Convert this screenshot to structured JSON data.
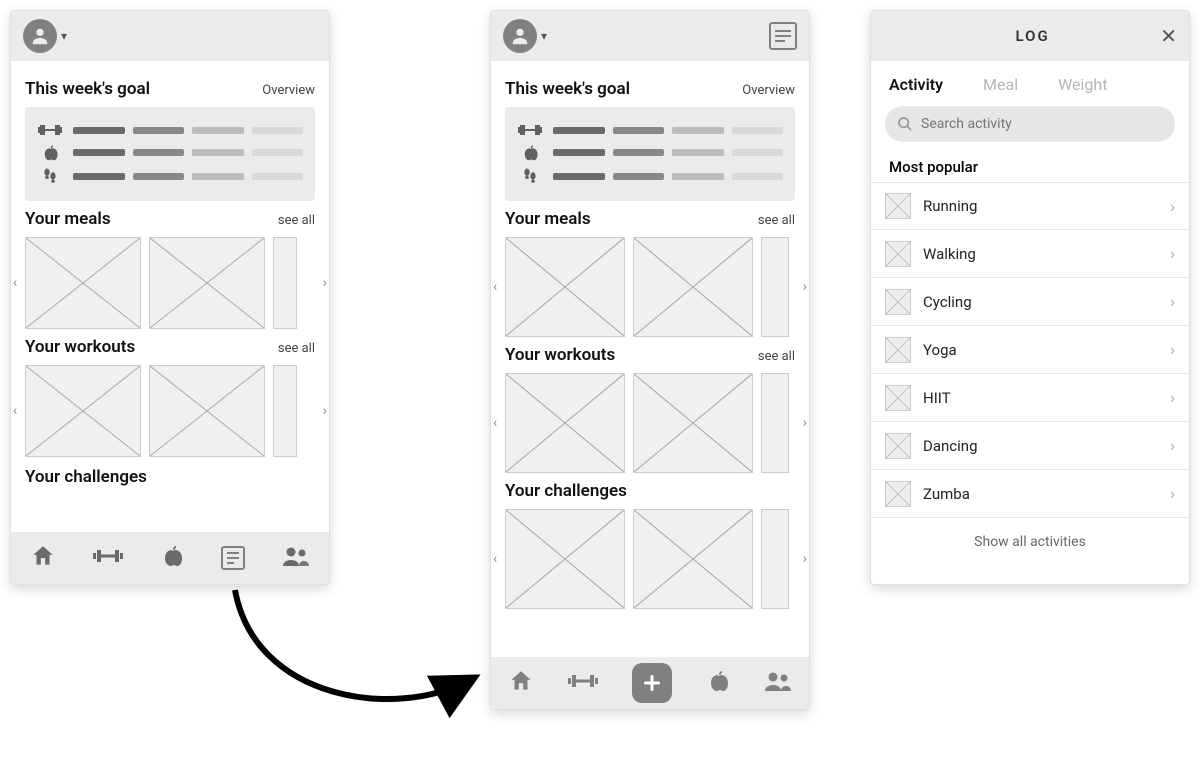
{
  "phoneA": {
    "sections": {
      "goal": {
        "title": "This week's goal",
        "link": "Overview"
      },
      "meals": {
        "title": "Your meals",
        "link": "see all"
      },
      "workouts": {
        "title": "Your workouts",
        "link": "see all"
      },
      "challenges": {
        "title": "Your challenges"
      }
    },
    "nav": {
      "home": "home-icon",
      "workout": "barbell-icon",
      "nutrition": "apple-icon",
      "log": "document-icon",
      "social": "people-icon"
    }
  },
  "phoneB": {
    "sections": {
      "goal": {
        "title": "This week's goal",
        "link": "Overview"
      },
      "meals": {
        "title": "Your meals",
        "link": "see all"
      },
      "workouts": {
        "title": "Your workouts",
        "link": "see all"
      },
      "challenges": {
        "title": "Your challenges"
      }
    }
  },
  "phoneC": {
    "title": "LOG",
    "tabs": {
      "activity": "Activity",
      "meal": "Meal",
      "weight": "Weight"
    },
    "search_placeholder": "Search activity",
    "popular_label": "Most popular",
    "activities": [
      "Running",
      "Walking",
      "Cycling",
      "Yoga",
      "HIIT",
      "Dancing",
      "Zumba"
    ],
    "show_all": "Show all activities"
  }
}
